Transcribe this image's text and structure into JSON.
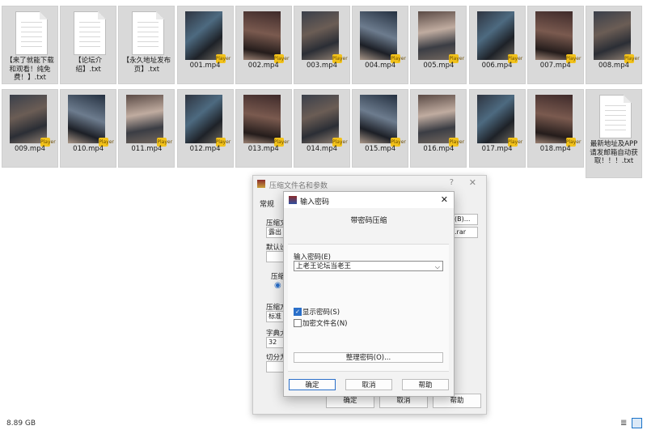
{
  "files_row1": [
    {
      "name": "【来了就能下载和观看！纯免费！】.txt",
      "type": "txt"
    },
    {
      "name": "【论坛介绍】.txt",
      "type": "txt"
    },
    {
      "name": "【永久地址发布页】.txt",
      "type": "txt"
    },
    {
      "name": "001.mp4",
      "type": "mp4"
    },
    {
      "name": "002.mp4",
      "type": "mp4"
    },
    {
      "name": "003.mp4",
      "type": "mp4"
    },
    {
      "name": "004.mp4",
      "type": "mp4"
    },
    {
      "name": "005.mp4",
      "type": "mp4"
    },
    {
      "name": "006.mp4",
      "type": "mp4"
    },
    {
      "name": "007.mp4",
      "type": "mp4"
    },
    {
      "name": "008.mp4",
      "type": "mp4"
    }
  ],
  "files_row2": [
    {
      "name": "009.mp4",
      "type": "mp4"
    },
    {
      "name": "010.mp4",
      "type": "mp4"
    },
    {
      "name": "011.mp4",
      "type": "mp4"
    },
    {
      "name": "012.mp4",
      "type": "mp4"
    },
    {
      "name": "013.mp4",
      "type": "mp4"
    },
    {
      "name": "014.mp4",
      "type": "mp4"
    },
    {
      "name": "015.mp4",
      "type": "mp4"
    },
    {
      "name": "016.mp4",
      "type": "mp4"
    },
    {
      "name": "017.mp4",
      "type": "mp4"
    },
    {
      "name": "018.mp4",
      "type": "mp4"
    },
    {
      "name": "最新地址及APP请发邮箱自动获取！！！.txt",
      "type": "txt"
    }
  ],
  "video_badge": "Player",
  "status_bar": {
    "size": "8.89 GB"
  },
  "archive_dialog": {
    "title": "压缩文件名和参数",
    "help_glyph": "?",
    "close_glyph": "✕",
    "tab": "常规",
    "fields": [
      "压缩文",
      "露出系",
      "默认设",
      "压缩",
      "压缩方",
      "标准",
      "字典大",
      "32",
      "切分为"
    ],
    "browse_label": "(B)...",
    "ext_label": ".rar",
    "ok": "确定",
    "cancel": "取消",
    "help": "帮助"
  },
  "password_dialog": {
    "title": "输入密码",
    "close_glyph": "✕",
    "heading": "带密码压缩",
    "password_label": "输入密码(E)",
    "password_value": "上老王论坛当老王",
    "show_password_label": "显示密码(S)",
    "show_password_checked": true,
    "encrypt_names_label": "加密文件名(N)",
    "encrypt_names_checked": false,
    "organize_button": "整理密码(O)...",
    "ok": "确定",
    "cancel": "取消",
    "help": "帮助"
  }
}
